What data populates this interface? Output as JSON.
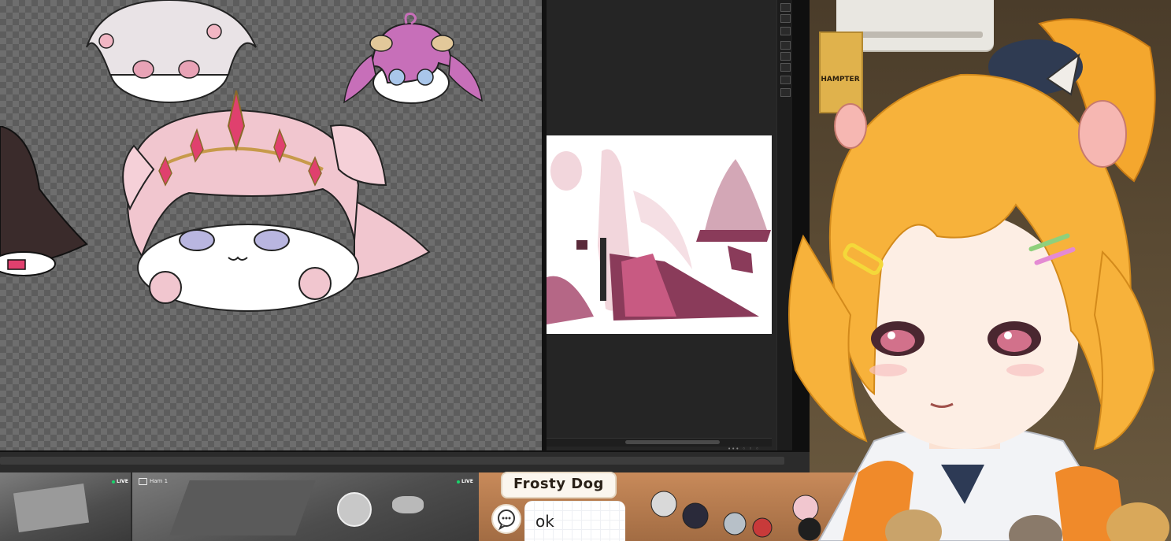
{
  "reference_panel": {
    "status_text": "••• ◦ ◦ ◦"
  },
  "room": {
    "poster_text": "HAMPTER"
  },
  "cameras": [
    {
      "label": "",
      "live": "LIVE"
    },
    {
      "label": "Ham 1",
      "live": "LIVE"
    }
  ],
  "chat": {
    "username": "Frosty Dog",
    "message": "ok"
  },
  "colors": {
    "canvas_checker_light": "#6e6e6e",
    "canvas_checker_dark": "#5d5d5d",
    "panel_dark": "#252525",
    "live_dot": "#19d46b",
    "avatar_hair": "#f7b23b",
    "avatar_hair_shadow": "#e08b1d",
    "chibi_pink": "#f1c6cf"
  },
  "icons": [
    "chat-bubble-icon",
    "camera-icon",
    "live-dot-icon"
  ]
}
